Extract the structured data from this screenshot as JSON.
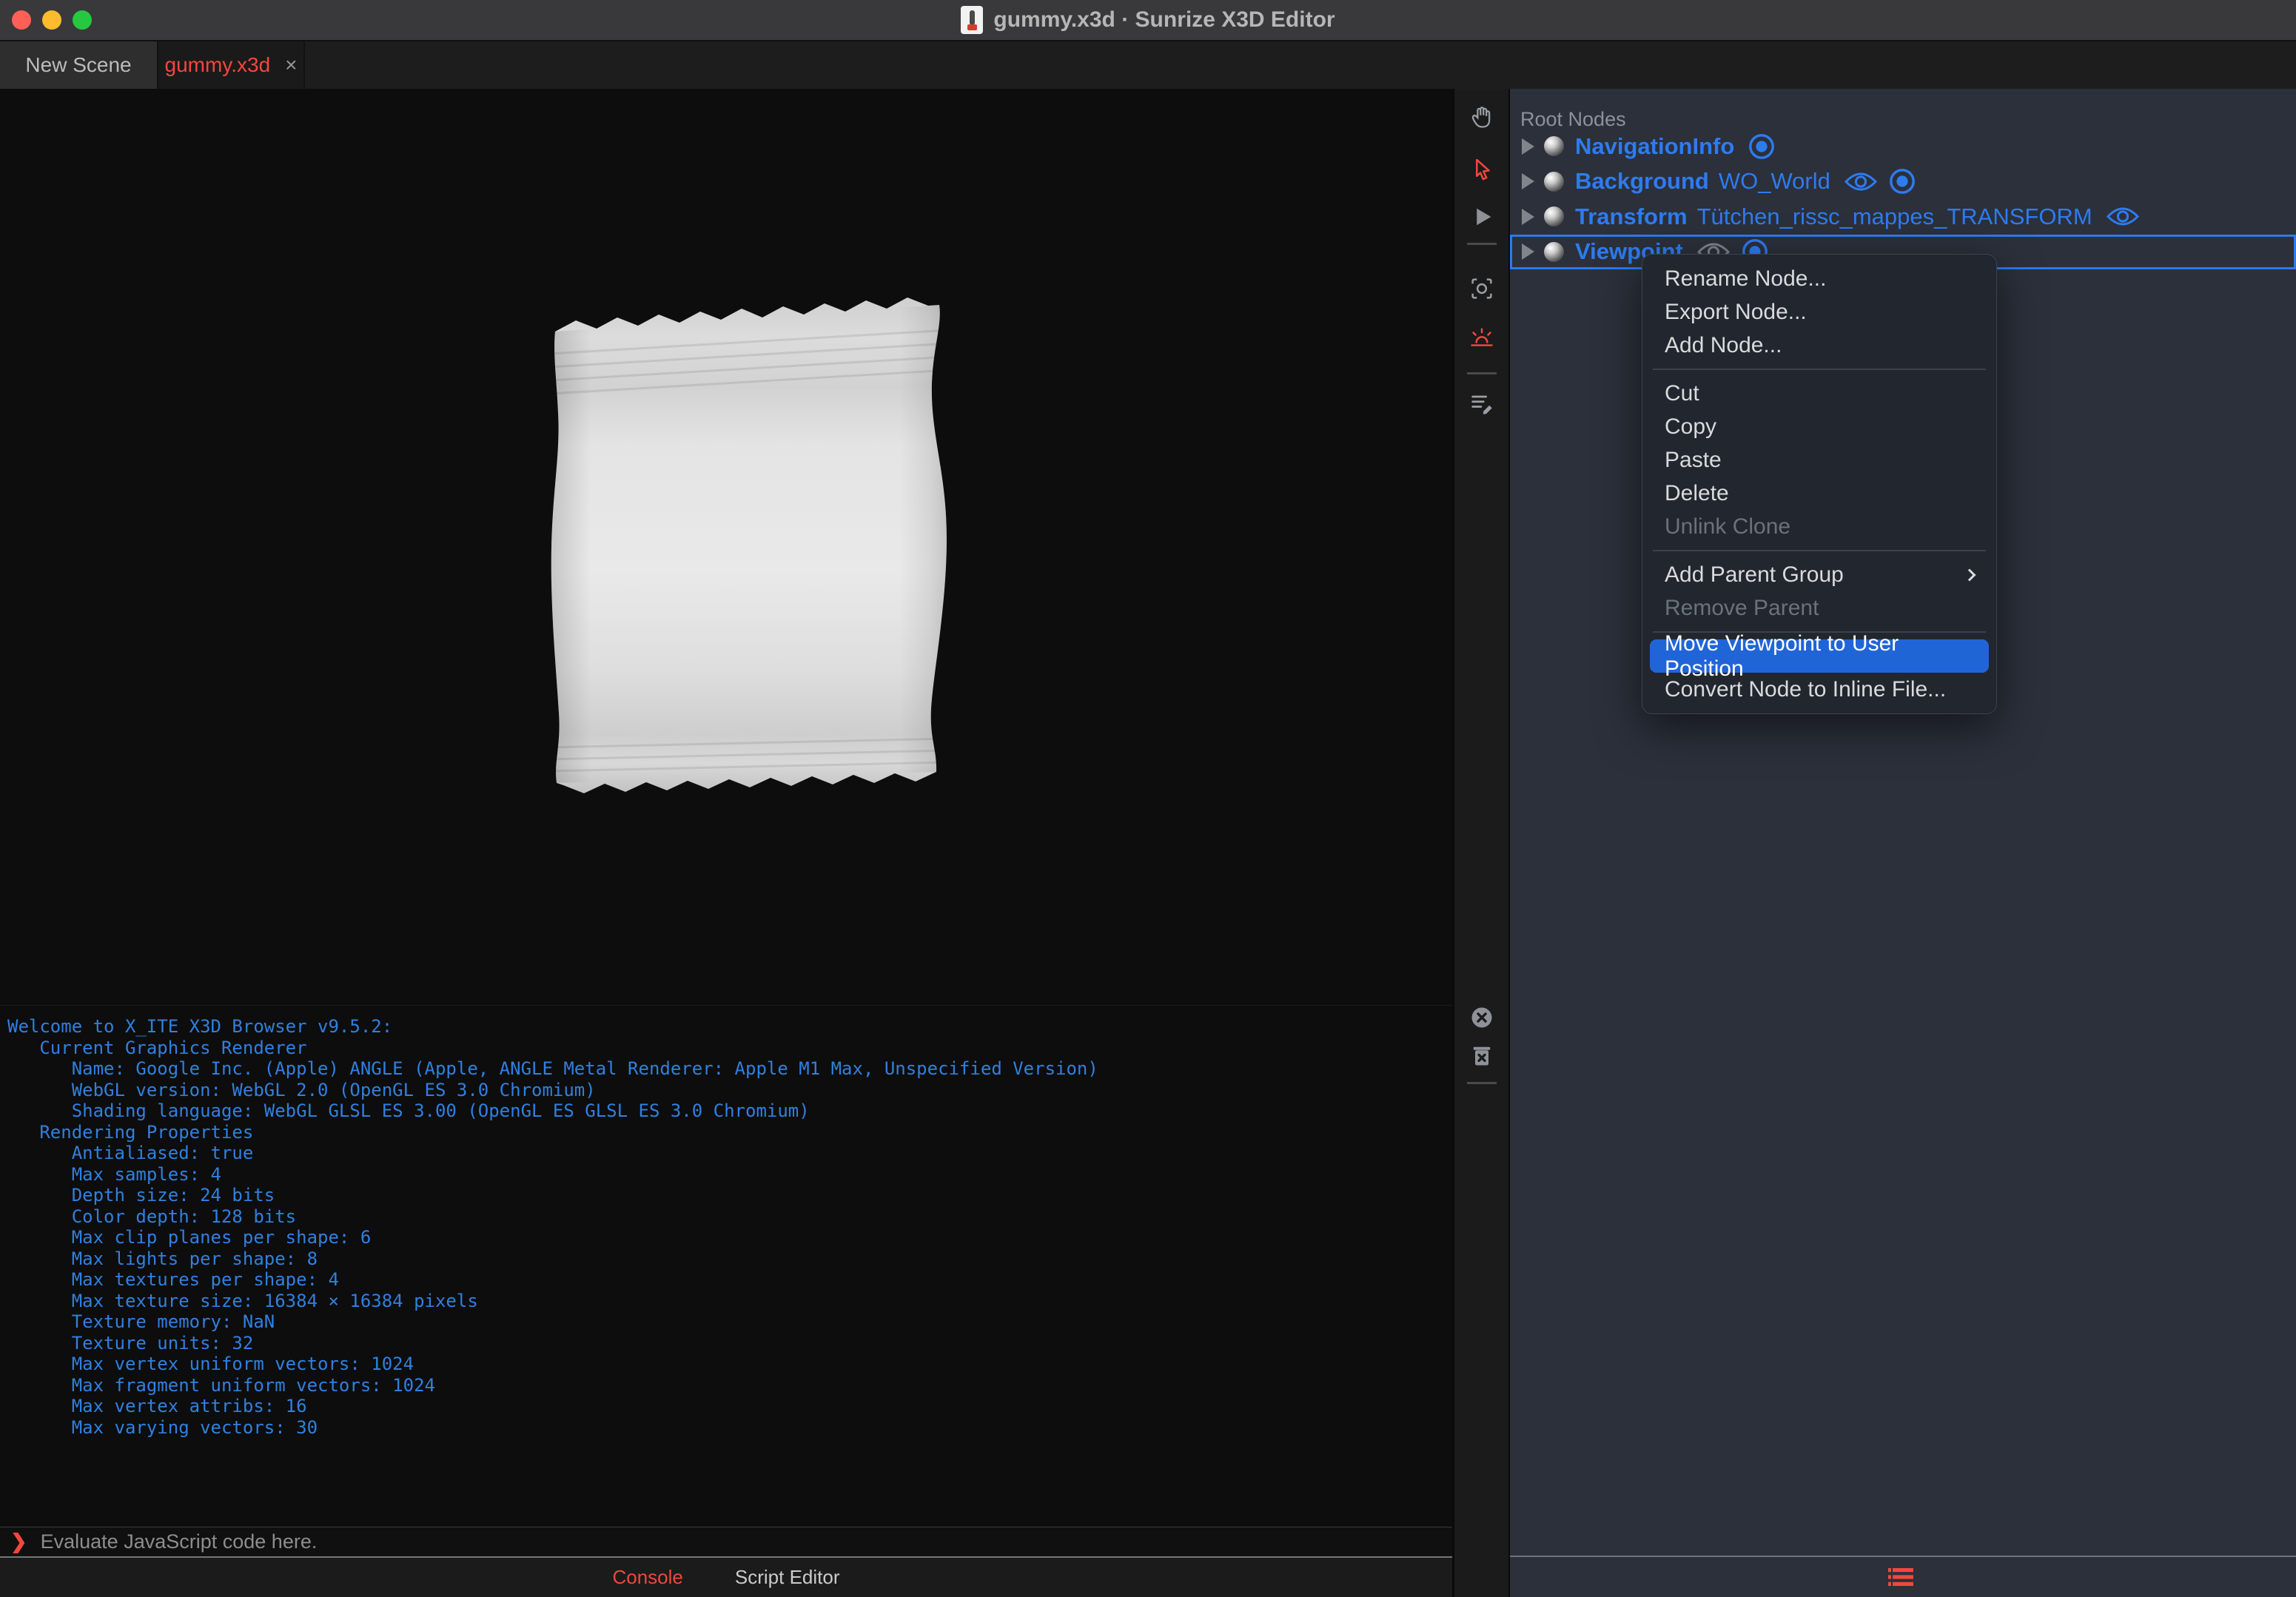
{
  "window": {
    "title": "gummy.x3d · Sunrize X3D Editor"
  },
  "tabs": [
    {
      "label": "New Scene",
      "active": false
    },
    {
      "label": "gummy.x3d",
      "active": true,
      "close": "×"
    }
  ],
  "outline": {
    "header": "Root Nodes",
    "rows": [
      {
        "type": "NavigationInfo",
        "name": "",
        "icons": [
          "bound"
        ],
        "selected": false
      },
      {
        "type": "Background",
        "name": "WO_World",
        "icons": [
          "eye",
          "bound"
        ],
        "selected": false
      },
      {
        "type": "Transform",
        "name": "Tütchen_rissc_mappes_TRANSFORM",
        "icons": [
          "eye"
        ],
        "selected": false
      },
      {
        "type": "Viewpoint",
        "name": "",
        "icons": [
          "eye",
          "bound"
        ],
        "selected": true
      }
    ]
  },
  "context_menu": {
    "items": [
      {
        "label": "Rename Node..."
      },
      {
        "label": "Export Node..."
      },
      {
        "label": "Add Node..."
      },
      {
        "separator": true
      },
      {
        "label": "Cut"
      },
      {
        "label": "Copy"
      },
      {
        "label": "Paste"
      },
      {
        "label": "Delete"
      },
      {
        "label": "Unlink Clone",
        "disabled": true
      },
      {
        "separator": true
      },
      {
        "label": "Add Parent Group",
        "submenu": true
      },
      {
        "label": "Remove Parent",
        "disabled": true
      },
      {
        "separator": true
      },
      {
        "label": "Move Viewpoint to User Position",
        "highlighted": true
      },
      {
        "label": "Convert Node to Inline File..."
      }
    ]
  },
  "console": {
    "prompt": "❯",
    "placeholder": "Evaluate JavaScript code here.",
    "lines": [
      "Welcome to X_ITE X3D Browser v9.5.2:",
      "   Current Graphics Renderer",
      "      Name: Google Inc. (Apple) ANGLE (Apple, ANGLE Metal Renderer: Apple M1 Max, Unspecified Version)",
      "      WebGL version: WebGL 2.0 (OpenGL ES 3.0 Chromium)",
      "      Shading language: WebGL GLSL ES 3.00 (OpenGL ES GLSL ES 3.0 Chromium)",
      "   Rendering Properties",
      "      Antialiased: true",
      "      Max samples: 4",
      "      Depth size: 24 bits",
      "      Color depth: 128 bits",
      "      Max clip planes per shape: 6",
      "      Max lights per shape: 8",
      "      Max textures per shape: 4",
      "      Max texture size: 16384 × 16384 pixels",
      "      Texture memory: NaN",
      "      Texture units: 32",
      "      Max vertex uniform vectors: 1024",
      "      Max fragment uniform vectors: 1024",
      "      Max vertex attribs: 16",
      "      Max varying vectors: 30"
    ]
  },
  "bottom_tabs": [
    {
      "label": "Console",
      "active": true
    },
    {
      "label": "Script Editor",
      "active": false
    }
  ],
  "colors": {
    "accent_red": "#f5473d",
    "node_blue": "#2e7bf0",
    "console_blue": "#3080df",
    "menu_highlight": "#2065d8",
    "selection_border": "#2b7af0"
  }
}
